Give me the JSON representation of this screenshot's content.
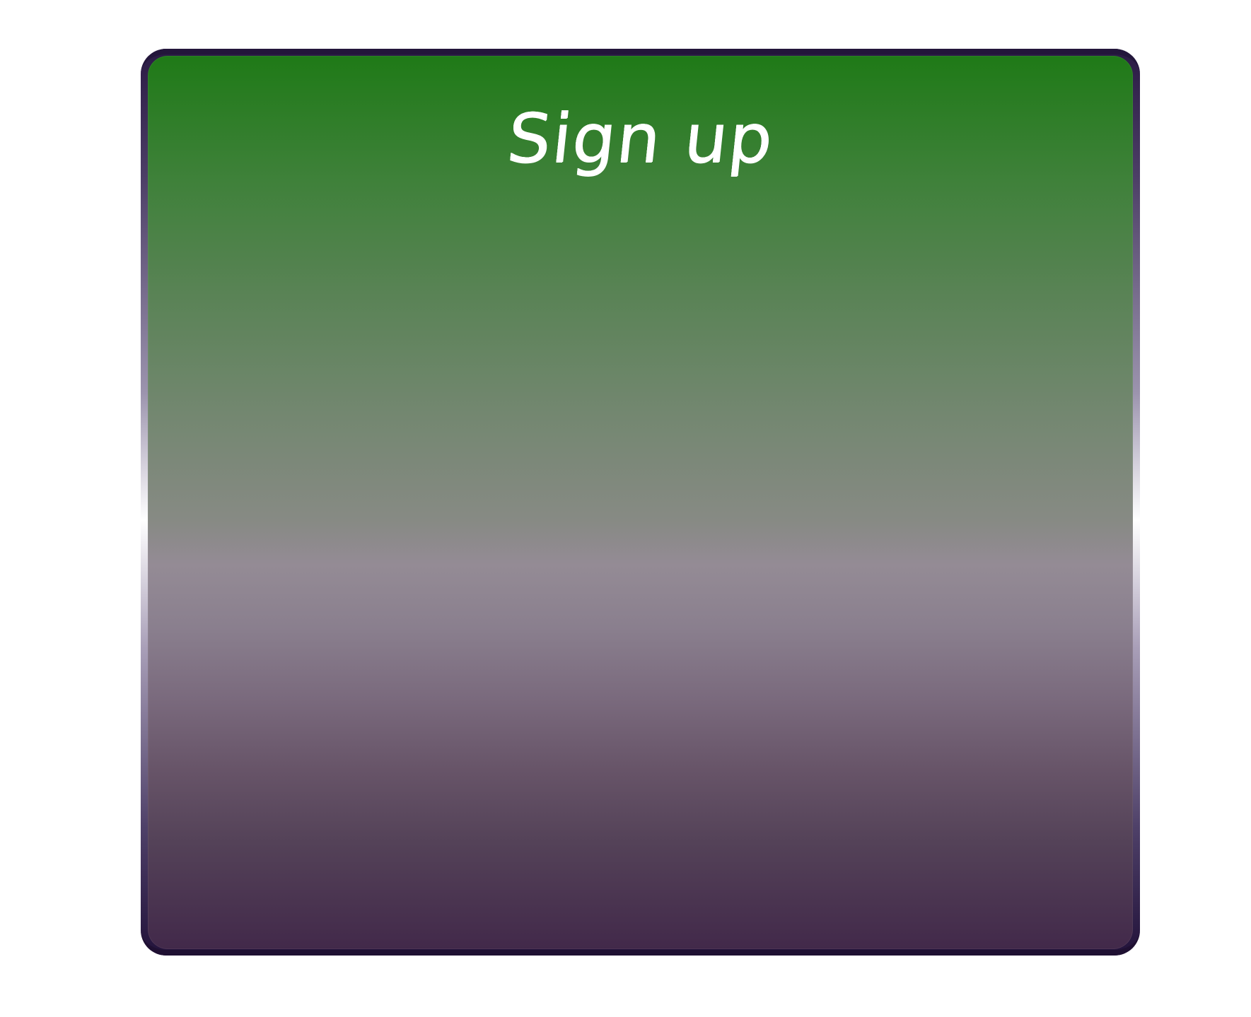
{
  "card": {
    "title": "Sign up"
  },
  "colors": {
    "page_background": "#ffffff",
    "panel_top": "#1f7a17",
    "panel_middle": "#948b95",
    "panel_bottom": "#42294a",
    "frame_dark": "#23163b",
    "title_text": "#ffffff"
  }
}
